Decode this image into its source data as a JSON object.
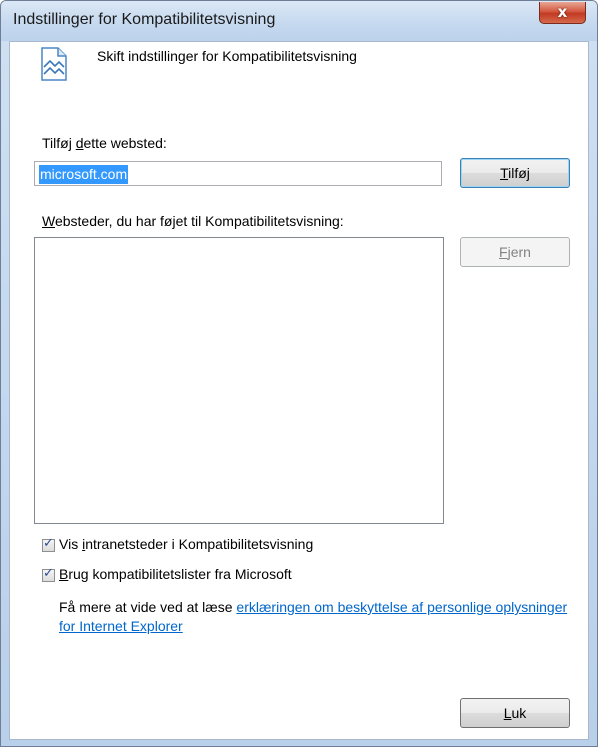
{
  "window": {
    "title": "Indstillinger for Kompatibilitetsvisning",
    "close_glyph": "x"
  },
  "header": {
    "icon": "compatibility-view-icon",
    "text": "Skift indstillinger for Kompatibilitetsvisning"
  },
  "add_site": {
    "label_before": "Tilføj ",
    "label_mnemonic": "d",
    "label_after": "ette websted:",
    "value": "microsoft.com",
    "button_mnemonic": "T",
    "button_rest": "ilføj"
  },
  "sites_list": {
    "label_mnemonic": "W",
    "label_rest": "ebsteder, du har føjet til Kompatibilitetsvisning:",
    "items": [],
    "remove_mnemonic": "F",
    "remove_rest": "jern"
  },
  "options": {
    "intranet": {
      "checked": true,
      "label_before": "Vis ",
      "label_mnemonic": "i",
      "label_after": "ntranetsteder i Kompatibilitetsvisning"
    },
    "ms_lists": {
      "checked": true,
      "label_mnemonic": "B",
      "label_after": "rug kompatibilitetslister fra Microsoft"
    }
  },
  "info": {
    "text": "Få mere at vide ved at læse ",
    "link": "erklæringen om beskyttelse af personlige oplysninger for Internet Explorer"
  },
  "close_button": {
    "mnemonic": "L",
    "rest": "uk"
  },
  "colors": {
    "link": "#0066cc",
    "selection": "#3399ff",
    "close_button": "#c13a22"
  }
}
